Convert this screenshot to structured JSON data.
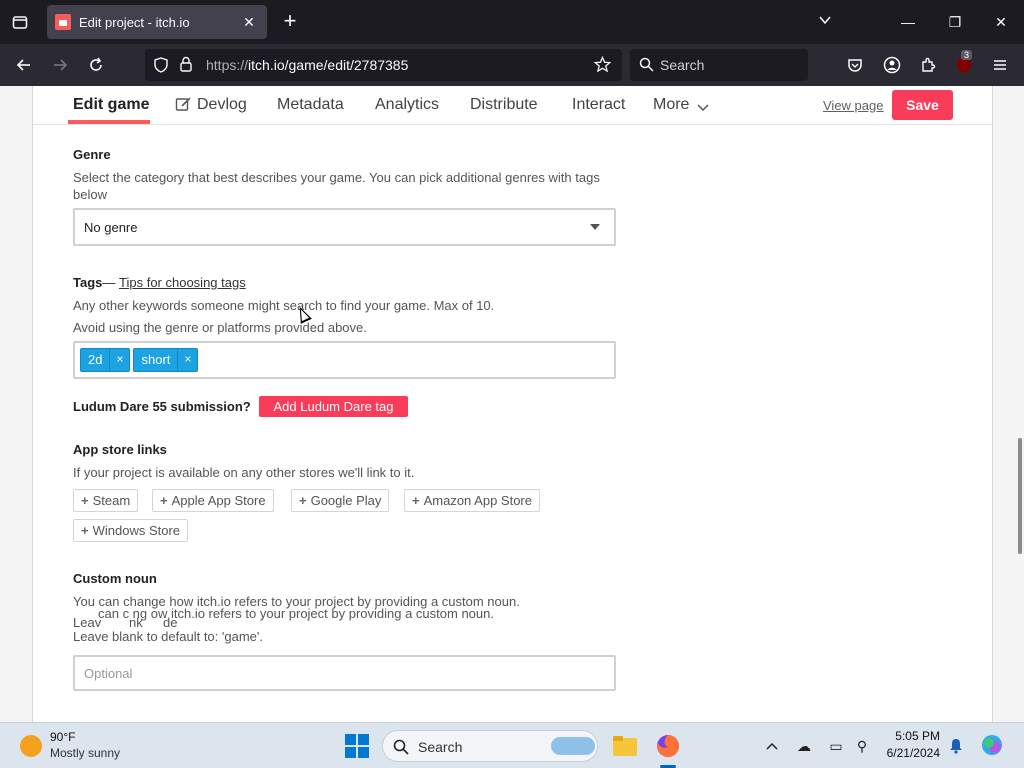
{
  "browser": {
    "tab_title": "Edit project - itch.io",
    "url_prefix": "https://",
    "url_main": "itch.io/game/edit/2787385",
    "search_placeholder": "Search",
    "extension_badge": "3"
  },
  "topnav": {
    "edit_game": "Edit game",
    "devlog": "Devlog",
    "metadata": "Metadata",
    "analytics": "Analytics",
    "distribute": "Distribute",
    "interact": "Interact",
    "more": "More",
    "view_page": "View page",
    "save": "Save"
  },
  "genre": {
    "label": "Genre",
    "description": "Select the category that best describes your game. You can pick additional genres with tags below",
    "selected": "No genre"
  },
  "tags": {
    "label": "Tags",
    "dash": "—",
    "tips_link": "Tips for choosing tags",
    "desc1": "Any other keywords someone might search to find your game. Max of 10.",
    "desc2": "Avoid using the genre or platforms provided above.",
    "items": [
      {
        "text": "2d",
        "remove": "×"
      },
      {
        "text": "short",
        "remove": "×"
      }
    ]
  },
  "ludum_dare": {
    "label": "Ludum Dare 55 submission?",
    "button": "Add Ludum Dare tag"
  },
  "app_store": {
    "label": "App store links",
    "description": "If your project is available on any other stores we'll link to it.",
    "buttons": [
      "Steam",
      "Apple App Store",
      "Google Play",
      "Amazon App Store",
      "Windows Store"
    ]
  },
  "custom_noun": {
    "label": "Custom noun",
    "desc1": "You can change how itch.io refers to your project by providing a custom noun.",
    "desc2": "Leave blank to default to: 'game'.",
    "placeholder": "Optional",
    "ghost_line": "can c  ng   ow itch.io refers to your project by providing a custom noun.",
    "ghost_prefix": "Leav",
    "ghost_nk": "nk",
    "ghost_de": "de"
  },
  "taskbar": {
    "temperature": "90°F",
    "weather": "Mostly sunny",
    "search": "Search",
    "time": "5:05 PM",
    "date": "6/21/2024"
  }
}
